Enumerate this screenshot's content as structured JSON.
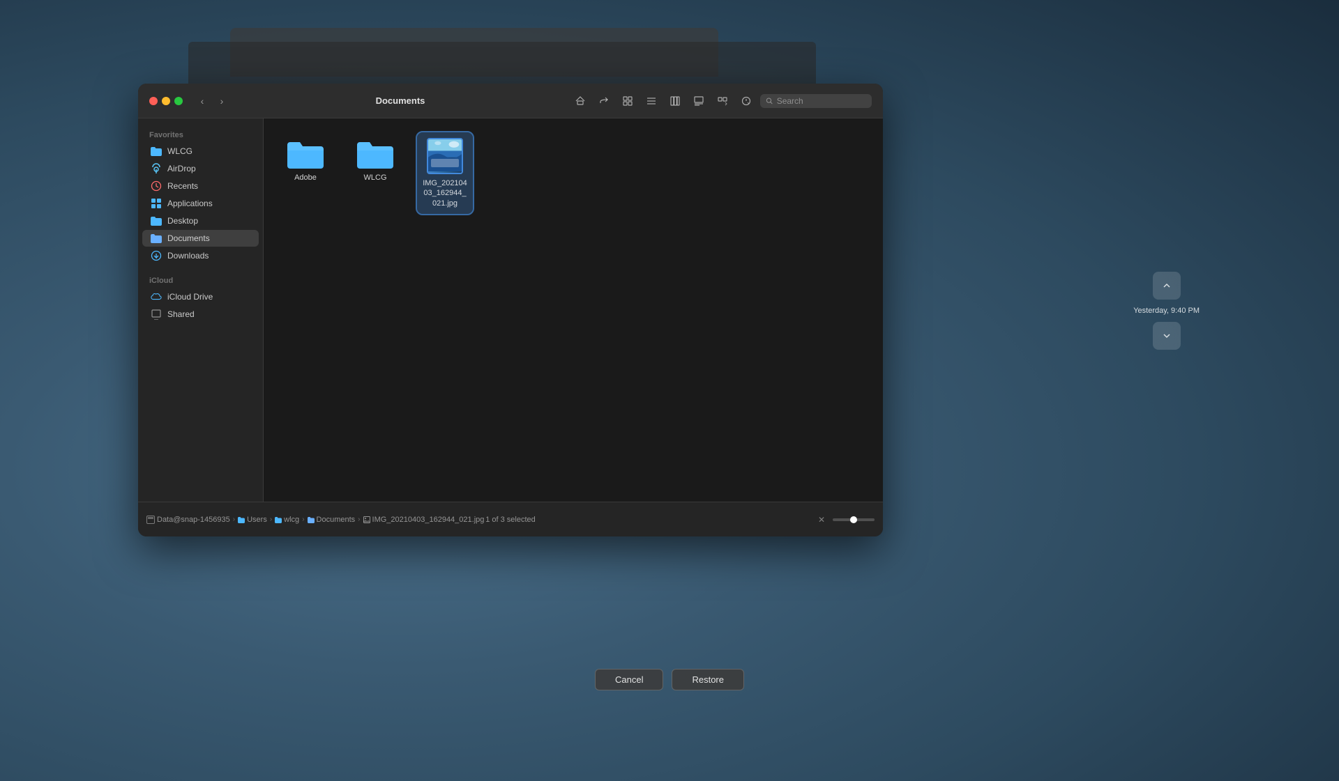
{
  "background": {
    "color": "#4a6070"
  },
  "notification": {
    "time": "Yesterday, 9:40 PM"
  },
  "window": {
    "title": "Documents",
    "search_placeholder": "Search"
  },
  "sidebar": {
    "favorites_header": "Favorites",
    "icloud_header": "iCloud",
    "items_favorites": [
      {
        "id": "wlcg",
        "label": "WLCG",
        "icon": "folder"
      },
      {
        "id": "airdrop",
        "label": "AirDrop",
        "icon": "airdrop"
      },
      {
        "id": "recents",
        "label": "Recents",
        "icon": "clock"
      },
      {
        "id": "applications",
        "label": "Applications",
        "icon": "grid"
      },
      {
        "id": "desktop",
        "label": "Desktop",
        "icon": "folder"
      },
      {
        "id": "documents",
        "label": "Documents",
        "icon": "folder-docs",
        "active": true
      },
      {
        "id": "downloads",
        "label": "Downloads",
        "icon": "arrow-down"
      }
    ],
    "items_icloud": [
      {
        "id": "icloud-drive",
        "label": "iCloud Drive",
        "icon": "cloud"
      },
      {
        "id": "shared",
        "label": "Shared",
        "icon": "share"
      }
    ]
  },
  "files": [
    {
      "id": "adobe",
      "name": "Adobe",
      "type": "folder"
    },
    {
      "id": "wlcg",
      "name": "WLCG",
      "type": "folder"
    },
    {
      "id": "img",
      "name": "IMG_20210403_162944_021.jpg",
      "type": "image",
      "selected": true
    }
  ],
  "status_bar": {
    "breadcrumb": [
      {
        "label": "Data@snap-1456935",
        "icon": "disk"
      },
      {
        "label": "Users",
        "icon": "folder"
      },
      {
        "label": "wlcg",
        "icon": "folder"
      },
      {
        "label": "Documents",
        "icon": "folder-docs"
      },
      {
        "label": "IMG_20210403_162944_021.jpg",
        "icon": "image"
      }
    ],
    "selection_info": "1 of 3 selected"
  },
  "buttons": {
    "cancel": "Cancel",
    "restore": "Restore"
  }
}
